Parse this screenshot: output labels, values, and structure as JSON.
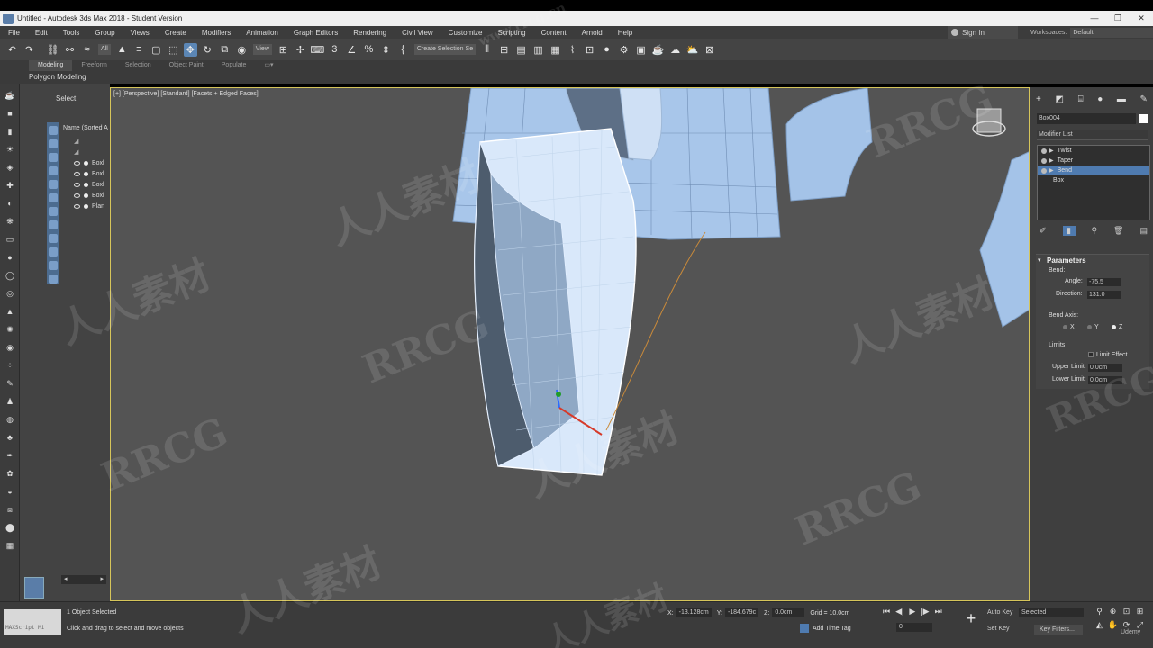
{
  "window": {
    "title": "Untitled - Autodesk 3ds Max 2018 - Student Version",
    "controls": [
      "—",
      "❐",
      "✕"
    ]
  },
  "menu": {
    "items": [
      "File",
      "Edit",
      "Tools",
      "Group",
      "Views",
      "Create",
      "Modifiers",
      "Animation",
      "Graph Editors",
      "Rendering",
      "Civil View",
      "Customize",
      "Scripting",
      "Content",
      "Arnold",
      "Help"
    ],
    "sign_in": "Sign In",
    "workspace_label": "Workspaces:",
    "workspace_value": "Default"
  },
  "toolbar": {
    "selection_filter": "All",
    "ref_coord": "View",
    "selection_set": "Create Selection Se"
  },
  "ribbon": {
    "tabs": [
      "Modeling",
      "Freeform",
      "Selection",
      "Object Paint",
      "Populate"
    ],
    "active_tab": "Modeling",
    "panel": "Polygon Modeling"
  },
  "scene_explorer": {
    "select_label": "Select",
    "header": "Name (Sorted A",
    "rows": [
      "Boxl",
      "Boxl",
      "Boxl",
      "Boxl",
      "Plan"
    ]
  },
  "viewport": {
    "label": "[+] [Perspective] [Standard] [Facets + Edged Faces]"
  },
  "command_panel": {
    "object_name": "Box004",
    "object_color": "#ffffff",
    "modifier_list": "Modifier List",
    "stack": [
      {
        "label": "Twist",
        "selected": false
      },
      {
        "label": "Taper",
        "selected": false
      },
      {
        "label": "Bend",
        "selected": true
      },
      {
        "label": "Box",
        "selected": false
      }
    ],
    "parameters": {
      "title": "Parameters",
      "bend_label": "Bend:",
      "angle_label": "Angle:",
      "angle_value": "-75.5",
      "direction_label": "Direction:",
      "direction_value": "131.0",
      "bend_axis_label": "Bend Axis:",
      "axes": [
        "X",
        "Y",
        "Z"
      ],
      "selected_axis": "Z",
      "limits_label": "Limits",
      "limit_effect_label": "Limit Effect",
      "upper_limit_label": "Upper Limit:",
      "upper_limit_value": "0.0cm",
      "lower_limit_label": "Lower Limit:",
      "lower_limit_value": "0.0cm"
    }
  },
  "status": {
    "maxscript": "MAXScript Mi",
    "selected": "1 Object Selected",
    "prompt": "Click and drag to select and move objects",
    "x_label": "X:",
    "x_value": "-13.128cm",
    "y_label": "Y:",
    "y_value": "-184.679c",
    "z_label": "Z:",
    "z_value": "0.0cm",
    "grid": "Grid = 10.0cm",
    "add_time_tag": "Add Time Tag",
    "frame": "0",
    "auto_key": "Auto Key",
    "set_key": "Set Key",
    "key_selected": "Selected",
    "key_filters": "Key Filters..."
  },
  "watermark": {
    "text_rrcg": "RRCG",
    "text_cn": "人人素材",
    "site": "www.rrcg.cn"
  },
  "branding": {
    "udemy": "Udemy"
  }
}
